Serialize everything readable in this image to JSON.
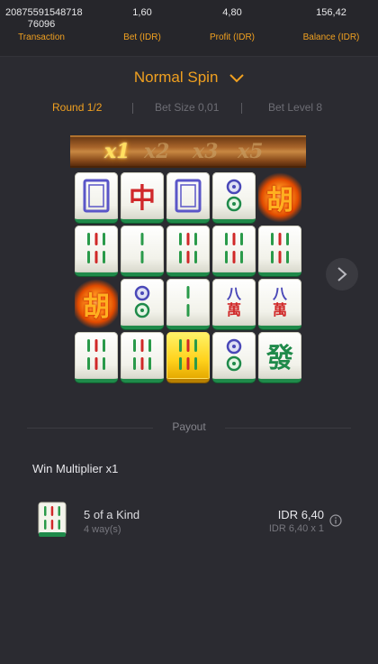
{
  "header": {
    "transaction_id_line1": "20875591548718",
    "transaction_id_line2": "76096",
    "transaction_label": "Transaction",
    "bet_value": "1,60",
    "bet_label": "Bet (IDR)",
    "profit_value": "4,80",
    "profit_label": "Profit (IDR)",
    "balance_value": "156,42",
    "balance_label": "Balance (IDR)"
  },
  "spin": {
    "title": "Normal Spin",
    "round": "Round 1/2",
    "bet_size": "Bet Size 0,01",
    "bet_level": "Bet Level 8"
  },
  "multipliers": [
    "x1",
    "x2",
    "x3",
    "x5"
  ],
  "active_multiplier_index": 0,
  "colors": {
    "accent": "#f0a020",
    "background": "#2b2b31",
    "tile_green": "#1f8a4a",
    "gold_tile": "#ffd21c"
  },
  "grid_symbols": [
    [
      "white-dragon",
      "red-dragon",
      "white-dragon",
      "two-dots",
      "wild"
    ],
    [
      "six-bamboo",
      "two-bamboo",
      "six-bamboo",
      "six-bamboo",
      "six-bamboo"
    ],
    [
      "wild",
      "two-dots",
      "two-bamboo",
      "eight-characters",
      "eight-characters"
    ],
    [
      "six-bamboo",
      "six-bamboo",
      "six-bamboo-gold",
      "two-dots",
      "green-dragon"
    ]
  ],
  "glyphs": {
    "red_dragon": "中",
    "wild": "胡",
    "eight_top": "八",
    "wan": "萬",
    "green_dragon": "發"
  },
  "payout": {
    "label": "Payout",
    "win_multiplier": "Win Multiplier x1",
    "kind": "5 of a Kind",
    "ways": "4 way(s)",
    "amount": "IDR 6,40",
    "calc": "IDR 6,40 x 1"
  }
}
